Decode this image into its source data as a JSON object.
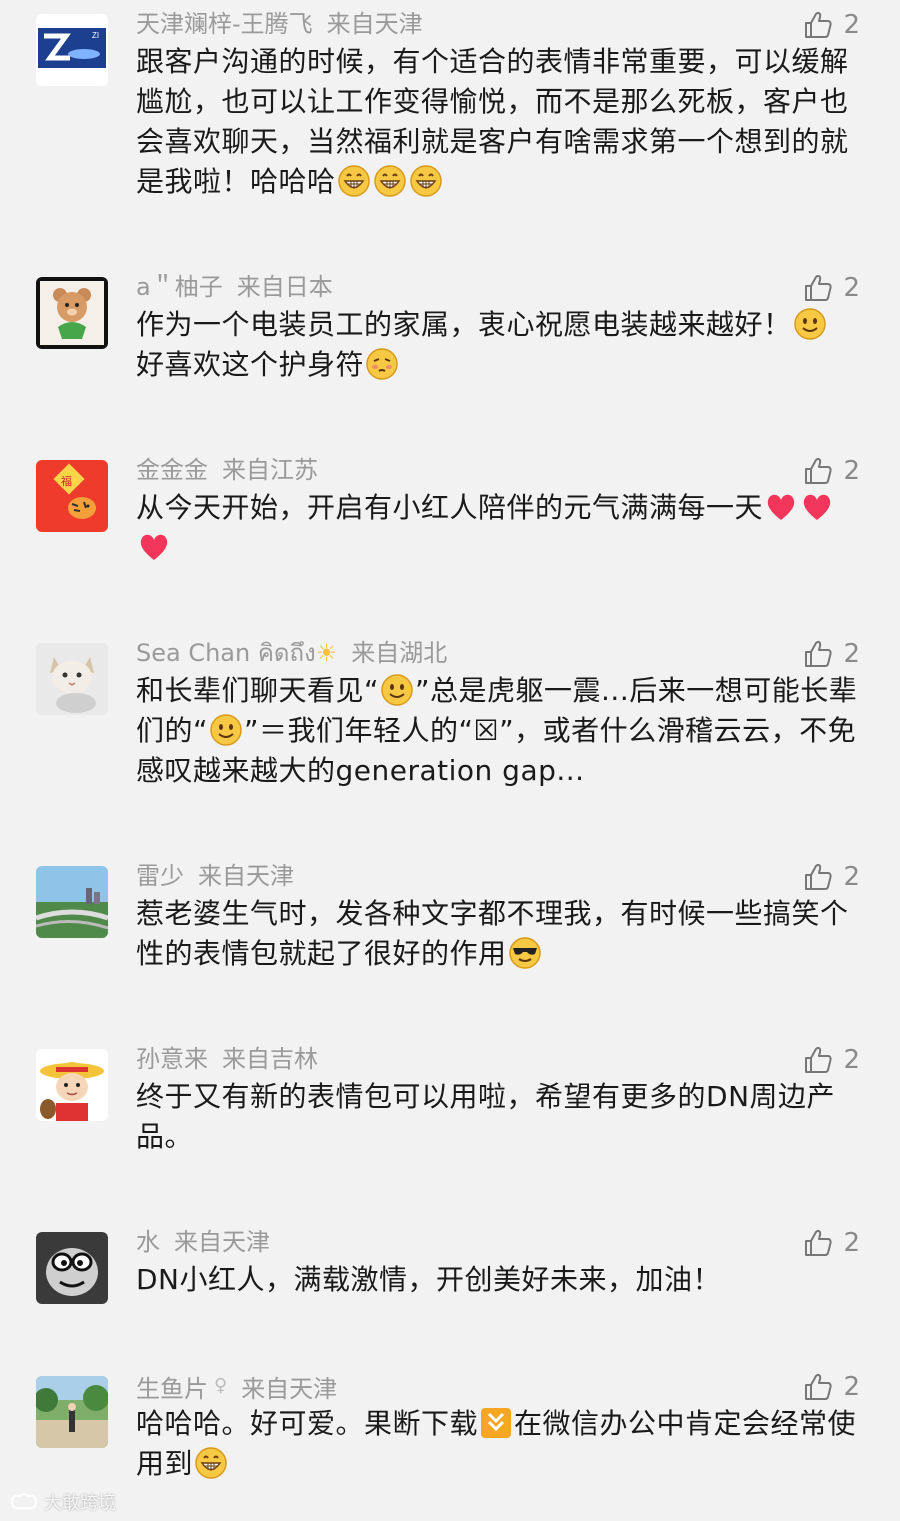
{
  "comments": [
    {
      "user": "天津斓梓-王腾飞",
      "location": "来自天津",
      "likes": "2",
      "avatar_icon": "z-logo-avatar",
      "text_parts": [
        "跟客户沟通的时候，有个适合的表情非常重要，可以缓解尴尬，也可以让工作变得愉悦，而不是那么死板，客户也会喜欢聊天，当然福利就是客户有啥需求第一个想到的就是我啦！哈哈哈"
      ],
      "emoji": [
        "grin-emoji",
        "grin-emoji",
        "grin-emoji"
      ]
    },
    {
      "user": "a＂柚子",
      "location": "来自日本",
      "likes": "2",
      "avatar_icon": "teddy-bear-avatar",
      "text_parts": [
        "作为一个电装员工的家属，衷心祝愿电装越来越好！",
        "好喜欢这个护身符"
      ],
      "emoji": [
        "smile-emoji",
        "shy-emoji"
      ]
    },
    {
      "user": "金金金",
      "location": "来自江苏",
      "likes": "2",
      "avatar_icon": "tiger-card-avatar",
      "text_parts": [
        "从今天开始，开启有小红人陪伴的元气满满每一天"
      ],
      "emoji": [
        "heart-emoji",
        "heart-emoji",
        "heart-emoji"
      ]
    },
    {
      "user": "Sea Chan คิดถึง",
      "location": "来自湖北",
      "likes": "2",
      "avatar_icon": "cat-avatar",
      "text_parts": [
        "和长辈们聊天看见“",
        "”总是虎躯一震...后来一想可能长辈们的“",
        "”＝我们年轻人的“☒”，或者什么滑稽云云，不免感叹越来越大的generation gap..."
      ],
      "emoji": [
        "smile-emoji",
        "smile-emoji"
      ]
    },
    {
      "user": "雷少",
      "location": "来自天津",
      "likes": "2",
      "avatar_icon": "city-avatar",
      "text_parts": [
        "惹老婆生气时，发各种文字都不理我，有时候一些搞笑个性的表情包就起了很好的作用"
      ],
      "emoji": [
        "sunglasses-emoji"
      ]
    },
    {
      "user": "孙意来",
      "location": "来自吉林",
      "likes": "2",
      "avatar_icon": "cartoon-boy-avatar",
      "text_parts": [
        "终于又有新的表情包可以用啦，希望有更多的DN周边产品。"
      ],
      "emoji": []
    },
    {
      "user": "水",
      "location": "来自天津",
      "likes": "2",
      "avatar_icon": "cartoon-face-avatar",
      "text_parts": [
        "DN小红人，满载激情，开创美好未来，加油！"
      ],
      "emoji": []
    },
    {
      "user": "生鱼片",
      "location": "来自天津",
      "likes": "2",
      "avatar_icon": "outdoor-photo-avatar",
      "text_parts": [
        "哈哈哈。好可爱。果断下载",
        "在微信办公中肯定会经常使用到"
      ],
      "emoji": [
        "download-emoji",
        "grin-emoji"
      ]
    }
  ],
  "watermark": "大敢跨境",
  "colors": {
    "background": "#f2f2f2",
    "meta_text": "#9a9a9a",
    "body_text": "#1a1a1a"
  }
}
